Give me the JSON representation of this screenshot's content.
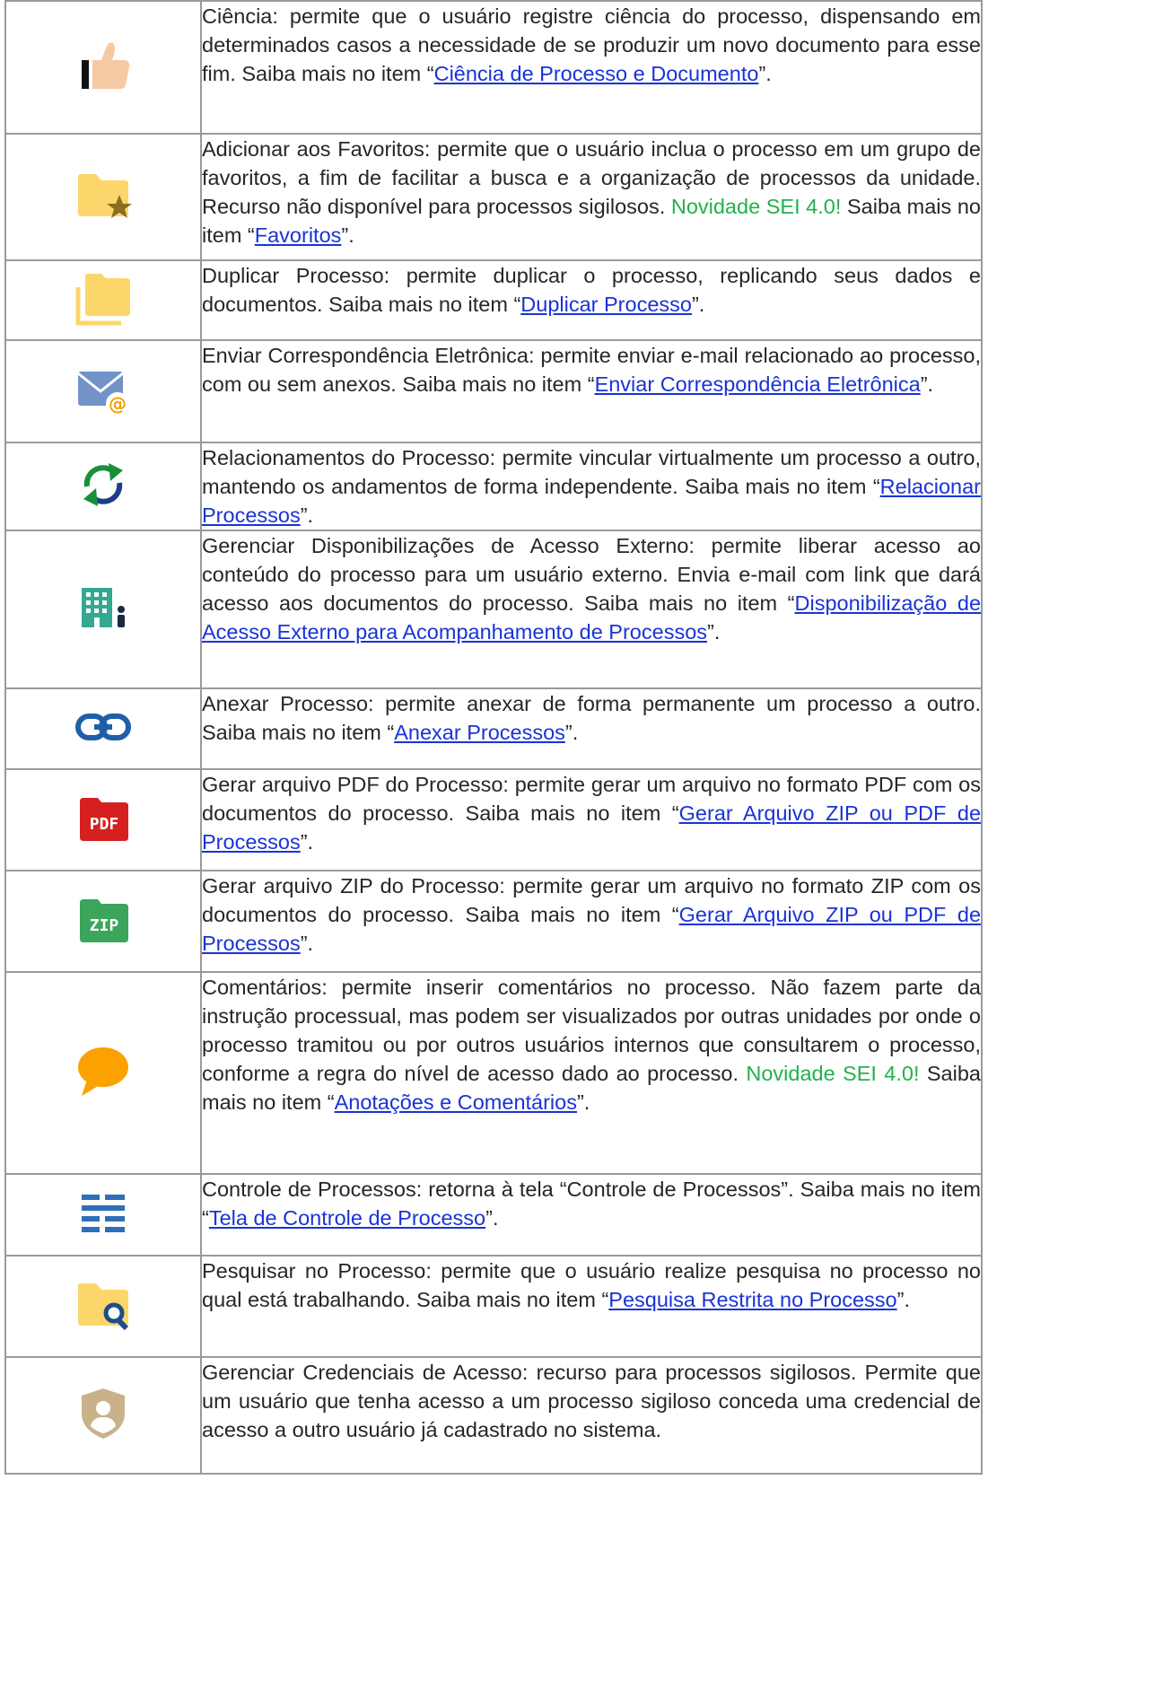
{
  "rows": [
    {
      "icon": "thumbs-up-icon",
      "before": "Ciência: permite que o usuário registre ciência do processo, dispensando em determinados casos a necessidade de se produzir um novo documento para esse fim. Saiba mais no item “",
      "link": "Ciência de Processo e Documento",
      "after": "”."
    },
    {
      "icon": "folder-star-icon",
      "before": "Adicionar aos Favoritos: permite que o usuário inclua o processo em um grupo de favoritos, a fim de facilitar a busca e a organização de processos da unidade. Recurso não disponível para processos sigilosos. ",
      "novidade": "Novidade SEI 4.0!",
      "before2": " Saiba mais no item “",
      "link": "Favoritos",
      "after": "”."
    },
    {
      "icon": "duplicate-folder-icon",
      "before": "Duplicar Processo: permite duplicar o processo, replicando seus dados e documentos. Saiba mais no item “",
      "link": "Duplicar Processo",
      "after": "”."
    },
    {
      "icon": "mail-at-icon",
      "before": "Enviar Correspondência Eletrônica: permite enviar e-mail relacionado ao processo, com ou sem anexos. Saiba mais no item “",
      "link": "Enviar Correspondência Eletrônica",
      "after": "”."
    },
    {
      "icon": "sync-arrows-icon",
      "before": "Relacionamentos do Processo: permite vincular virtualmente um processo a outro, mantendo os andamentos de forma independente. Saiba mais no item “",
      "link": "Relacionar Processos",
      "after": "”."
    },
    {
      "icon": "building-person-icon",
      "before": "Gerenciar Disponibilizações de Acesso Externo: permite liberar acesso ao conteúdo do processo para um usuário externo. Envia e-mail com link que dará acesso aos documentos do processo. Saiba mais no item “",
      "link": "Disponibilização de Acesso Externo para Acompanhamento de Processos",
      "after": "”."
    },
    {
      "icon": "link-icon",
      "before": "Anexar Processo: permite anexar de forma permanente um processo a outro. Saiba mais no item “",
      "link": "Anexar Processos",
      "after": "”."
    },
    {
      "icon": "pdf-file-icon",
      "label": "PDF",
      "before": "Gerar arquivo PDF do Processo: permite gerar um arquivo no formato PDF com os documentos do processo. Saiba mais no item “",
      "link": "Gerar Arquivo ZIP ou PDF de Processos",
      "after": "”."
    },
    {
      "icon": "zip-file-icon",
      "label": "ZIP",
      "before": "Gerar arquivo ZIP do Processo: permite gerar um arquivo no formato ZIP com os documentos do processo. Saiba mais no item “",
      "link": "Gerar Arquivo ZIP ou PDF de Processos",
      "after": "”."
    },
    {
      "icon": "comment-bubble-icon",
      "before": "Comentários: permite inserir comentários no processo. Não fazem parte da instrução processual, mas podem ser visualizados por outras unidades por onde o processo tramitou ou por outros usuários internos que consultarem o processo, conforme a regra do nível de acesso dado ao processo. ",
      "novidade": "Novidade SEI 4.0!",
      "before2": " Saiba mais no item “",
      "link": "Anotações e Comentários",
      "after": "”."
    },
    {
      "icon": "list-lines-icon",
      "before": "Controle de Processos: retorna à tela “Controle de Processos”. Saiba mais no item “",
      "link": "Tela de Controle de Processo",
      "after": "”."
    },
    {
      "icon": "folder-search-icon",
      "before": "Pesquisar no Processo: permite que o usuário realize pesquisa no processo no qual está trabalhando. Saiba mais no item “",
      "link": "Pesquisa Restrita no Processo",
      "after": "”."
    },
    {
      "icon": "shield-user-icon",
      "before": "Gerenciar Credenciais de Acesso: recurso para processos sigilosos. Permite que um usuário que tenha acesso a um processo sigiloso conceda uma credencial de acesso a outro usuário já cadastrado no sistema."
    }
  ]
}
